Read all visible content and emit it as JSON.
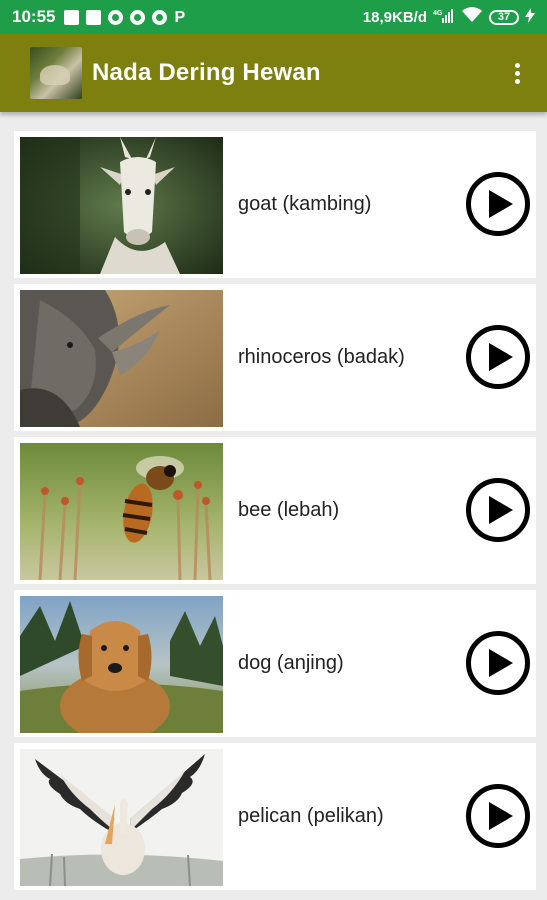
{
  "status": {
    "time": "10:55",
    "network_speed": "18,9KB/d",
    "network_type": "4G",
    "battery": "37",
    "notification_icons": [
      "message-icon",
      "music-app-icon",
      "chrome-icon",
      "chrome-icon",
      "chrome-icon",
      "p-app-icon"
    ],
    "p_glyph": "P"
  },
  "appbar": {
    "title": "Nada Dering Hewan",
    "logo_icon": "app-logo",
    "menu_icon": "overflow-menu-icon"
  },
  "animals": [
    {
      "label": "goat (kambing)",
      "thumb": "goat"
    },
    {
      "label": "rhinoceros (badak)",
      "thumb": "rhinoceros"
    },
    {
      "label": "bee (lebah)",
      "thumb": "bee"
    },
    {
      "label": "dog (anjing)",
      "thumb": "dog"
    },
    {
      "label": "pelican (pelikan)",
      "thumb": "pelican"
    }
  ],
  "colors": {
    "status_bar": "#1f9e4a",
    "app_bar": "#7d7f0f",
    "list_background": "#ececec"
  }
}
